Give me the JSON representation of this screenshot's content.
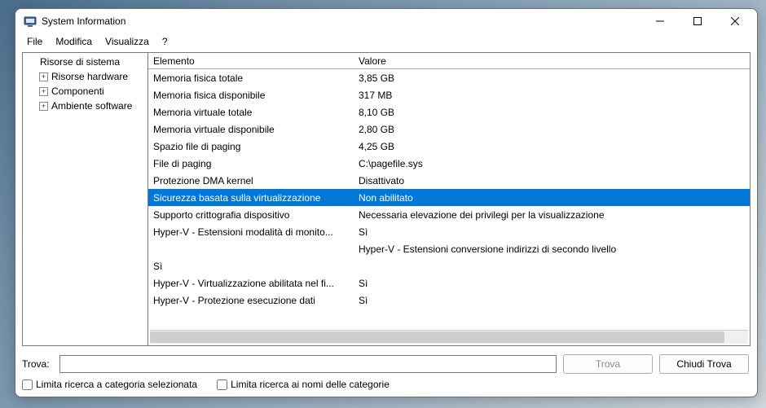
{
  "window": {
    "title": "System Information"
  },
  "menu": {
    "file": "File",
    "edit": "Modifica",
    "view": "Visualizza",
    "help": "?"
  },
  "tree": {
    "root": "Risorse di sistema",
    "items": [
      "Risorse hardware",
      "Componenti",
      "Ambiente software"
    ]
  },
  "list": {
    "headers": {
      "element": "Elemento",
      "value": "Valore"
    },
    "rows": [
      {
        "el": "Memoria fisica totale",
        "val": "3,85 GB"
      },
      {
        "el": "Memoria fisica disponibile",
        "val": "317 MB"
      },
      {
        "el": "Memoria virtuale totale",
        "val": "8,10 GB"
      },
      {
        "el": "Memoria virtuale disponibile",
        "val": "2,80 GB"
      },
      {
        "el": "Spazio file di paging",
        "val": "4,25 GB"
      },
      {
        "el": "File di paging",
        "val": "C:\\pagefile.sys"
      },
      {
        "el": "Protezione DMA kernel",
        "val": "Disattivato"
      },
      {
        "el": "Sicurezza basata sulla virtualizzazione",
        "val": "Non abilitato",
        "selected": true
      },
      {
        "el": "Supporto crittografia dispositivo",
        "val": "Necessaria elevazione dei privilegi per la visualizzazione"
      },
      {
        "el": "Hyper-V - Estensioni modalità di monito...",
        "val": "Sì"
      },
      {
        "el": "",
        "val": "Hyper-V - Estensioni conversione indirizzi di secondo livello"
      },
      {
        "el": "Sì",
        "val": ""
      },
      {
        "el": "Hyper-V - Virtualizzazione abilitata nel fi...",
        "val": "Sì"
      },
      {
        "el": "Hyper-V - Protezione esecuzione dati",
        "val": "Sì"
      }
    ]
  },
  "find": {
    "label": "Trova:",
    "value": "",
    "find_btn": "Trova",
    "close_btn": "Chiudi Trova",
    "limit_category": "Limita ricerca a categoria selezionata",
    "limit_names": "Limita ricerca ai nomi delle categorie"
  }
}
